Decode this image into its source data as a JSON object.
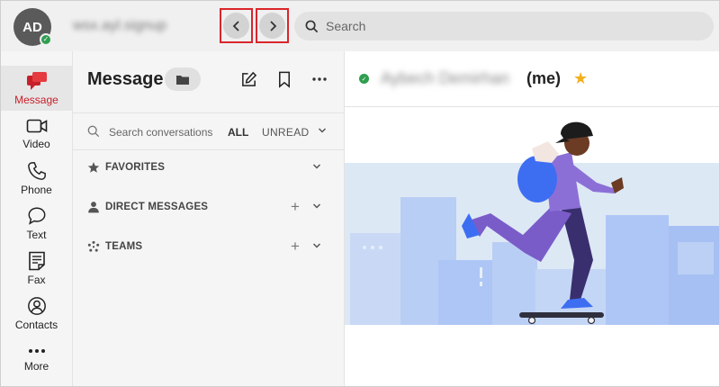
{
  "account": {
    "initials": "AD",
    "name": "wsx.ayl.signup"
  },
  "search": {
    "placeholder": "Search"
  },
  "nav": [
    {
      "label": "Message",
      "icon": "message-icon"
    },
    {
      "label": "Video",
      "icon": "video-icon"
    },
    {
      "label": "Phone",
      "icon": "phone-icon"
    },
    {
      "label": "Text",
      "icon": "text-icon"
    },
    {
      "label": "Fax",
      "icon": "fax-icon"
    },
    {
      "label": "Contacts",
      "icon": "contacts-icon"
    },
    {
      "label": "More",
      "icon": "more-icon"
    }
  ],
  "panel": {
    "title": "Message",
    "search_placeholder": "Search conversations",
    "filter_all": "ALL",
    "filter_unread": "UNREAD",
    "sections": [
      {
        "label": "FAVORITES",
        "addable": false
      },
      {
        "label": "DIRECT MESSAGES",
        "addable": true
      },
      {
        "label": "TEAMS",
        "addable": true
      }
    ],
    "plus_label": "+"
  },
  "conversation": {
    "name": "Aybech Demirhan",
    "me_tag": "(me)",
    "star": "★"
  },
  "colors": {
    "accent": "#d9262b",
    "presence": "#2e9e4f",
    "star": "#f2b01e",
    "illustration_sky": "#dde8f5"
  }
}
